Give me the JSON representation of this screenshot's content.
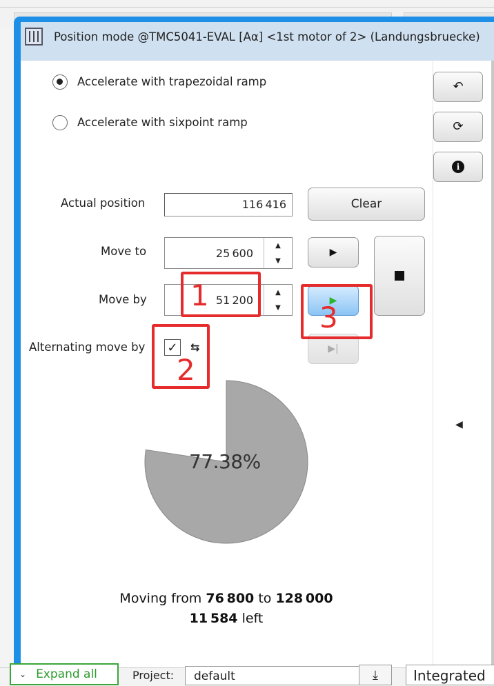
{
  "window": {
    "title": "Position mode @TMC5041-EVAL [Aα] <1st motor of 2> (Landungsbruecke)",
    "title_icon": "sliders-icon"
  },
  "ramp": {
    "trapezoidal_label": "Accelerate with trapezoidal ramp",
    "sixpoint_label": "Accelerate with sixpoint ramp",
    "selected": "trapezoidal"
  },
  "side_buttons": {
    "undo_icon": "undo-icon",
    "refresh_icon": "refresh-icon",
    "info_icon": "info-icon"
  },
  "actual_position": {
    "label": "Actual position",
    "value": "116 416",
    "clear_label": "Clear"
  },
  "move_to": {
    "label": "Move to",
    "value": "25 600"
  },
  "move_by": {
    "label": "Move by",
    "value": "51 200"
  },
  "alternating": {
    "label": "Alternating move by",
    "checked": true
  },
  "annotations": [
    "1",
    "2",
    "3"
  ],
  "progress": {
    "percent_label": "77.38%",
    "fraction": 0.7738,
    "fill_color": "#a8a8a8"
  },
  "status": {
    "moving_prefix": "Moving from",
    "from": "76 800",
    "to_word": "to",
    "to": "128 000",
    "left_value": "11 584",
    "left_suffix": "left"
  },
  "bottom_bar": {
    "expand_label": "Expand all",
    "project_label": "Project:",
    "project_value": "default",
    "integrated_label": "Integrated"
  },
  "colors": {
    "accent_blue": "#1e8fe6",
    "annotation_red": "#e52b2b"
  }
}
